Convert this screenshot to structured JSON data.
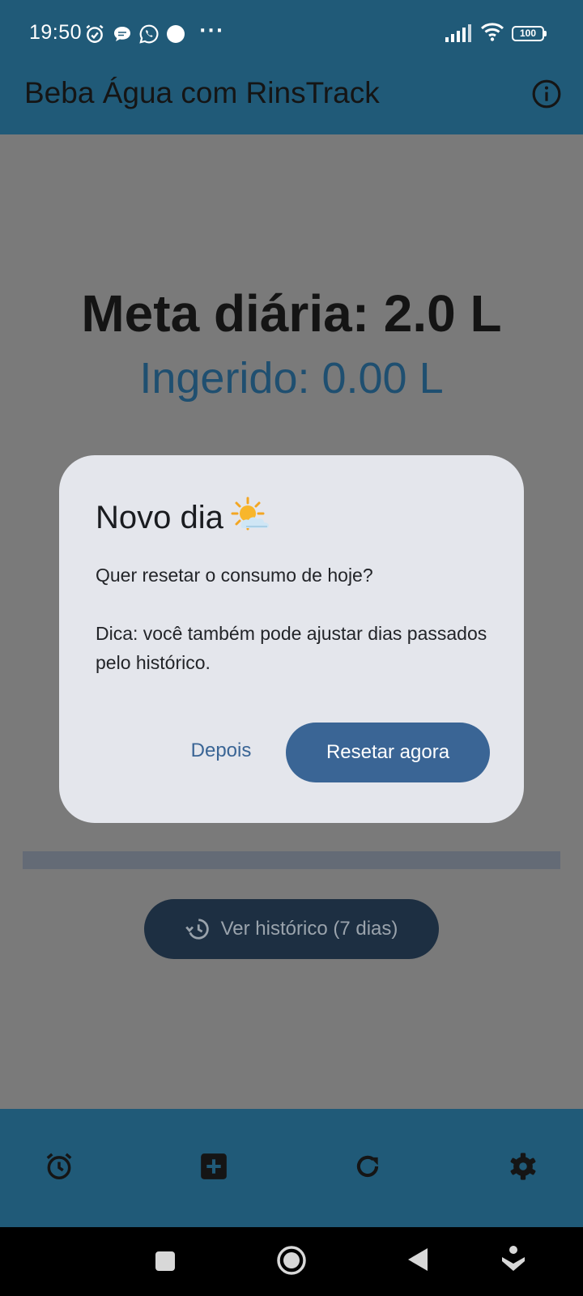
{
  "status_bar": {
    "time": "19:50",
    "battery": "100",
    "icons": [
      "alarm-icon",
      "chat-bubble-icon",
      "whatsapp-icon",
      "notification-dot-icon",
      "more-icon",
      "signal-icon",
      "wifi-icon",
      "battery-icon"
    ]
  },
  "app_bar": {
    "title": "Beba Água com RinsTrack",
    "info_icon": "info-icon"
  },
  "main": {
    "goal_text": "Meta diária: 2.0 L",
    "ingested_text": "Ingerido: 0.00 L",
    "progress": 0,
    "history_button": "Ver histórico (7 dias)",
    "history_icon": "history-icon"
  },
  "dialog": {
    "title": "Novo dia",
    "title_icon": "sun-behind-cloud-icon",
    "body_line1": "Quer resetar o consumo de hoje?",
    "body_line2": "Dica: você também pode ajustar dias passados pelo histórico.",
    "later_label": "Depois",
    "reset_label": "Resetar agora"
  },
  "bottom_nav": {
    "items": [
      "alarm-icon",
      "add-box-icon",
      "refresh-icon",
      "settings-icon"
    ]
  },
  "system_nav": {
    "items": [
      "recents-icon",
      "home-icon",
      "back-icon",
      "assistant-icon"
    ]
  },
  "colors": {
    "bar": "#205a78",
    "scrim_bg": "#7a7a7a",
    "dialog_bg": "#e4e6ec",
    "accent": "#3a6595",
    "ingested_text": "#1f4f70"
  }
}
